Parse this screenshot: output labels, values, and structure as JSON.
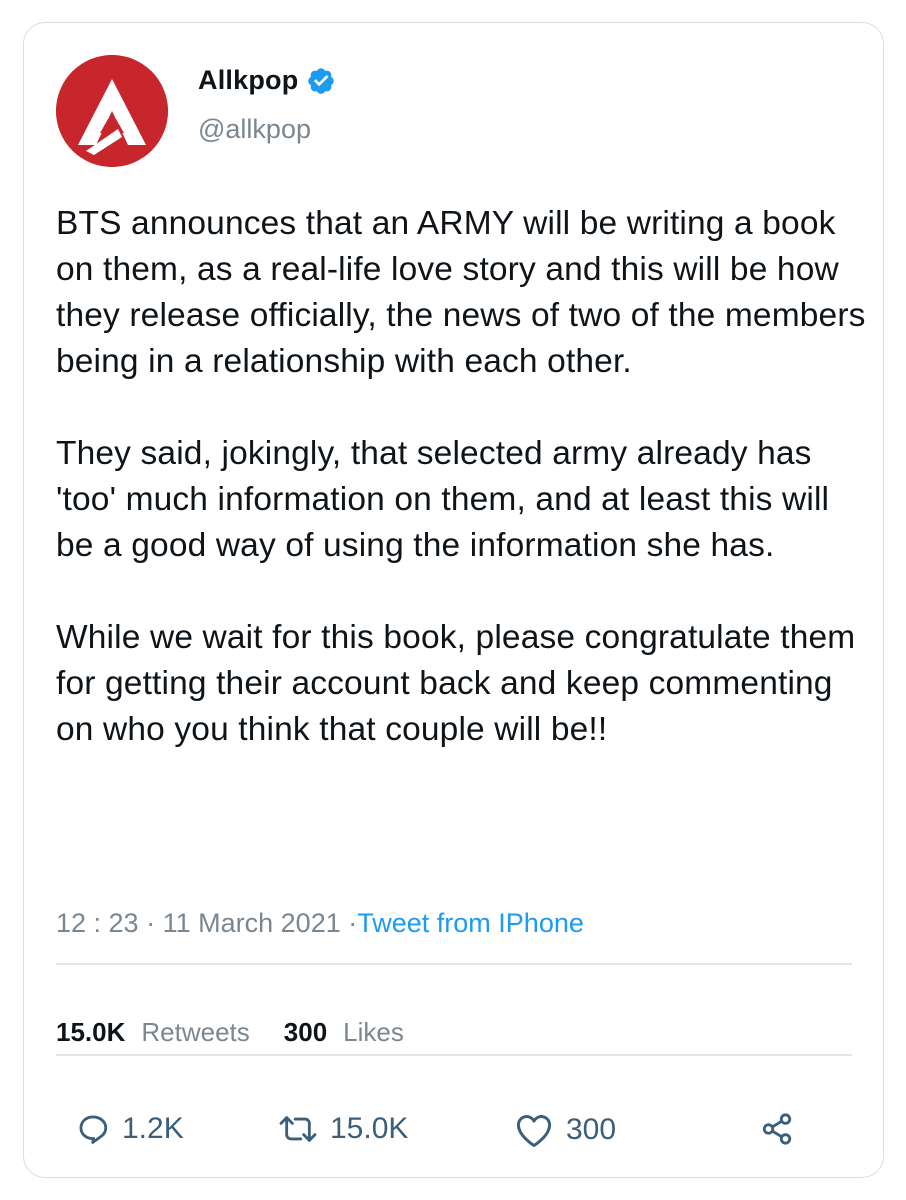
{
  "account": {
    "display_name": "Allkpop",
    "handle": "@allkpop",
    "verified_icon": "verified-badge-icon",
    "avatar_icon": "allkpop-logo",
    "brand_color": "#c8262d"
  },
  "tweet": {
    "paragraphs": [
      "BTS announces that an ARMY will be writing a book on them, as a real-life love story and this will be how they release officially, the news of two of the members being in a relationship with each other.",
      "They said, jokingly, that selected army already has 'too' much information on them, and at least this will be a good way of using the information she has.",
      "While we wait for this book, please congratulate them for getting their account back and keep commenting on who you think that couple will be!!"
    ],
    "time": "12 : 23",
    "separator": "·",
    "date": "11 March 2021",
    "source_separator": "·",
    "source": "Tweet from IPhone"
  },
  "stats": {
    "retweets_count": "15.0K",
    "retweets_label": "Retweets",
    "likes_count": "300",
    "likes_label": "Likes"
  },
  "actions": {
    "reply_count": "1.2K",
    "retweet_count": "15.0K",
    "like_count": "300",
    "colors": {
      "text": "#7b8790",
      "link": "#1d9bf0",
      "action": "#3b5f7b"
    }
  }
}
